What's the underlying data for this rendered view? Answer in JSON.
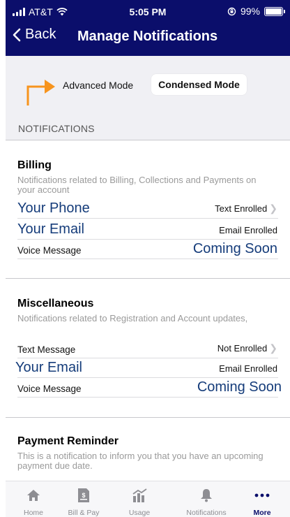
{
  "status": {
    "carrier": "AT&T",
    "time": "5:05 PM",
    "battery": "99%"
  },
  "nav": {
    "back_label": "Back",
    "title": "Manage Notifications"
  },
  "modes": {
    "advanced": "Advanced Mode",
    "condensed": "Condensed Mode",
    "selected": "Condensed Mode"
  },
  "section_header": "NOTIFICATIONS",
  "colors": {
    "nav_bg": "#0b0e6b",
    "arrow": "#f7941d",
    "highlight_text": "#153c7a"
  },
  "sections": [
    {
      "title": "Billing",
      "description": "Notifications related to Billing, Collections and Payments on your account",
      "rows": [
        {
          "label": "Your Phone",
          "value": "Text Enrolled"
        },
        {
          "label": "Your Email",
          "value": "Email Enrolled"
        },
        {
          "label": "Voice Message",
          "value": "Coming Soon"
        }
      ]
    },
    {
      "title": "Miscellaneous",
      "description": "Notifications related to Registration and Account updates,",
      "rows": [
        {
          "label": "Text Message",
          "value": "Not Enrolled"
        },
        {
          "label": "Your Email",
          "value": "Email Enrolled"
        },
        {
          "label": "Voice Message",
          "value": "Coming Soon"
        }
      ]
    },
    {
      "title": "Payment Reminder",
      "description": "This is a notification to inform you that you have an upcoming payment due date.",
      "rows": []
    }
  ],
  "tabs": [
    {
      "label": "Home",
      "icon": "home-icon"
    },
    {
      "label": "Bill & Pay",
      "icon": "bill-icon"
    },
    {
      "label": "Usage",
      "icon": "usage-chart-icon"
    },
    {
      "label": "Notifications",
      "icon": "bell-icon"
    },
    {
      "label": "More",
      "icon": "more-dots-icon"
    }
  ],
  "active_tab": "More"
}
